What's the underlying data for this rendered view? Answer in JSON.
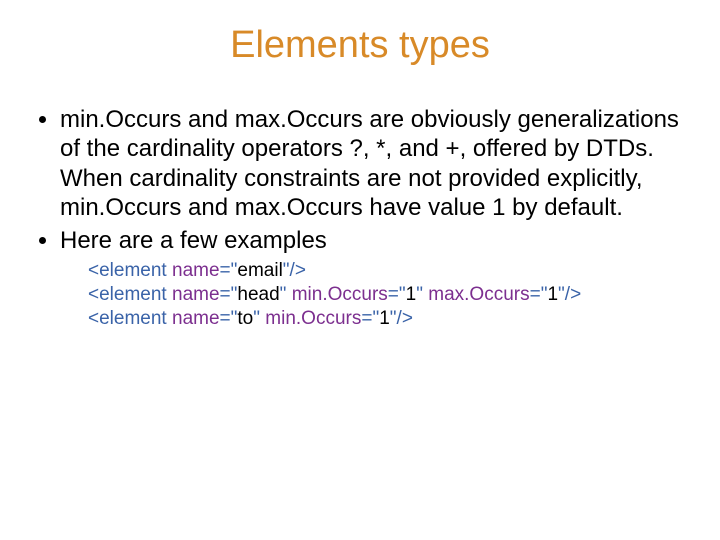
{
  "title": "Elements types",
  "bullets": {
    "b1": "min.Occurs and max.Occurs are obviously generalizations of the cardinality operators ?, *, and +, offered by DTDs. When cardinality constraints are not provided explicitly, min.Occurs and max.Occurs have value 1 by default.",
    "b2": "Here are a few examples"
  },
  "ex": {
    "lt": "<",
    "gt": "/>",
    "tag": "element",
    "sp": " ",
    "eq": "=",
    "q": "\"",
    "attr_name": "name",
    "attr_min": "min.Occurs",
    "attr_max": "max.Occurs",
    "email": "email",
    "head": "head",
    "to": "to",
    "one": "1"
  }
}
